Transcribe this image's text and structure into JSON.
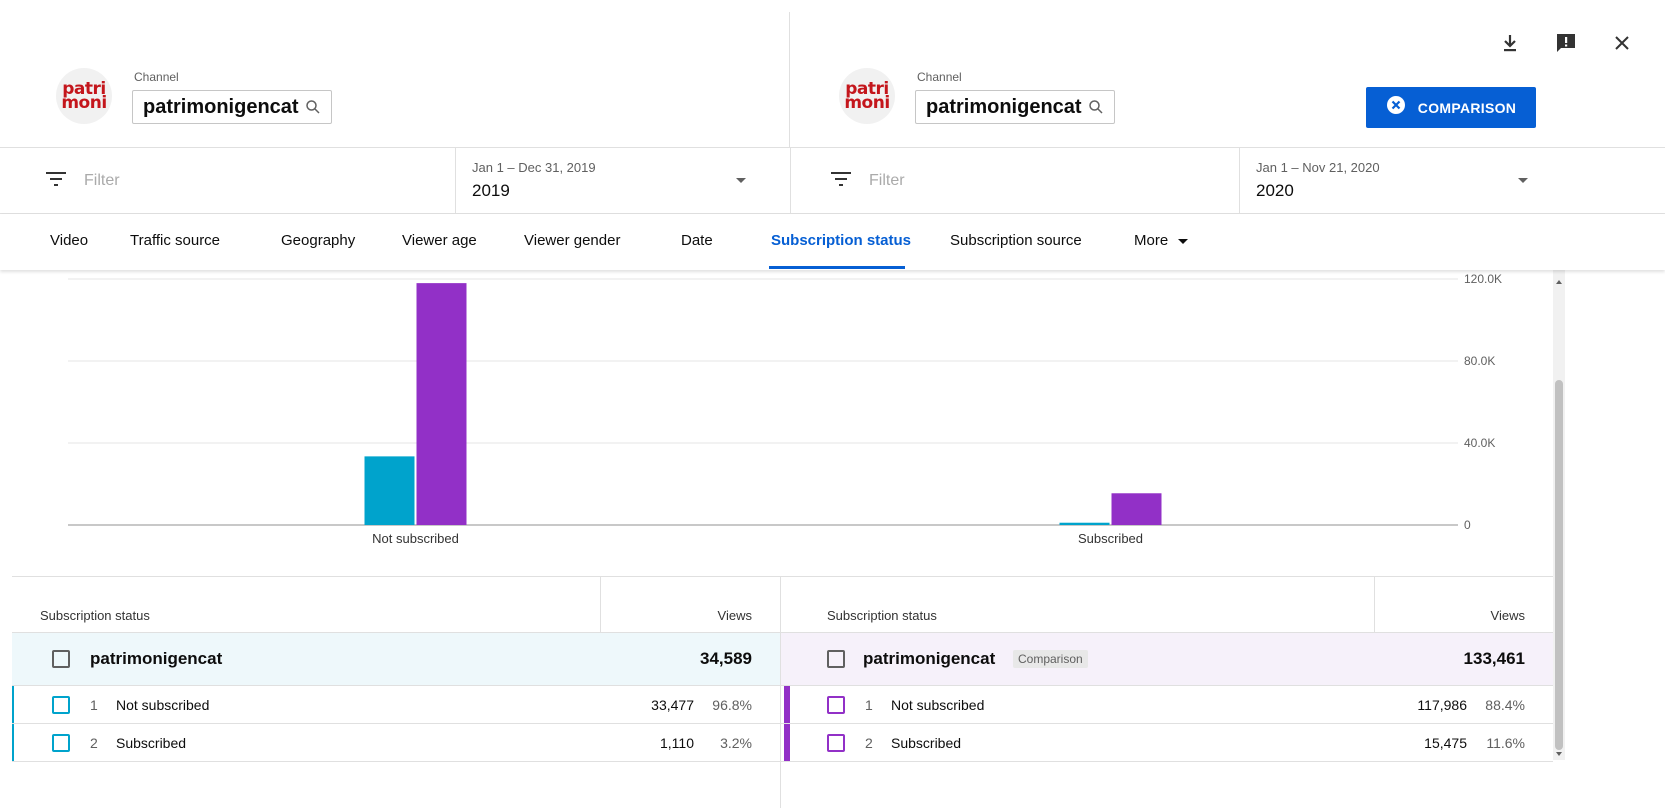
{
  "header": {
    "left": {
      "channel_label": "Channel",
      "channel_name": "patrimonigencat",
      "logo_top": "patri",
      "logo_bottom": "moni"
    },
    "right": {
      "channel_label": "Channel",
      "channel_name": "patrimonigencat",
      "logo_top": "patri",
      "logo_bottom": "moni"
    },
    "comparison_button": "COMPARISON",
    "icons": [
      "download-icon",
      "feedback-icon",
      "close-icon"
    ]
  },
  "filters": {
    "left": {
      "placeholder": "Filter",
      "date_range": "Jan 1 – Dec 31, 2019",
      "date_value": "2019"
    },
    "right": {
      "placeholder": "Filter",
      "date_range": "Jan 1 – Nov 21, 2020",
      "date_value": "2020"
    }
  },
  "tabs": [
    {
      "label": "Video"
    },
    {
      "label": "Traffic source"
    },
    {
      "label": "Geography"
    },
    {
      "label": "Viewer age"
    },
    {
      "label": "Viewer gender"
    },
    {
      "label": "Date"
    },
    {
      "label": "Subscription status",
      "active": true
    },
    {
      "label": "Subscription source"
    },
    {
      "label": "More"
    }
  ],
  "chart_data": {
    "type": "bar",
    "categories": [
      "Not subscribed",
      "Subscribed"
    ],
    "series": [
      {
        "values": [
          33477,
          1110
        ],
        "color": "#00a3cc"
      },
      {
        "values": [
          117986,
          15475
        ],
        "color": "#9230c7"
      }
    ],
    "ylim": [
      0,
      120000
    ],
    "y_ticks": [
      {
        "value": 0,
        "label": "0"
      },
      {
        "value": 40000,
        "label": "40.0K"
      },
      {
        "value": 80000,
        "label": "80.0K"
      },
      {
        "value": 120000,
        "label": "120.0K"
      }
    ],
    "grid": true,
    "y_axis_side": "right"
  },
  "tables": {
    "left": {
      "col_label": "Subscription status",
      "col_value": "Views",
      "total": {
        "name": "patrimonigencat",
        "value": "34,589"
      },
      "rows": [
        {
          "idx": "1",
          "label": "Not subscribed",
          "value": "33,477",
          "pct": "96.8%"
        },
        {
          "idx": "2",
          "label": "Subscribed",
          "value": "1,110",
          "pct": "3.2%"
        }
      ]
    },
    "right": {
      "col_label": "Subscription status",
      "col_value": "Views",
      "total": {
        "name": "patrimonigencat",
        "badge": "Comparison",
        "value": "133,461"
      },
      "rows": [
        {
          "idx": "1",
          "label": "Not subscribed",
          "value": "117,986",
          "pct": "88.4%"
        },
        {
          "idx": "2",
          "label": "Subscribed",
          "value": "15,475",
          "pct": "11.6%"
        }
      ]
    }
  }
}
